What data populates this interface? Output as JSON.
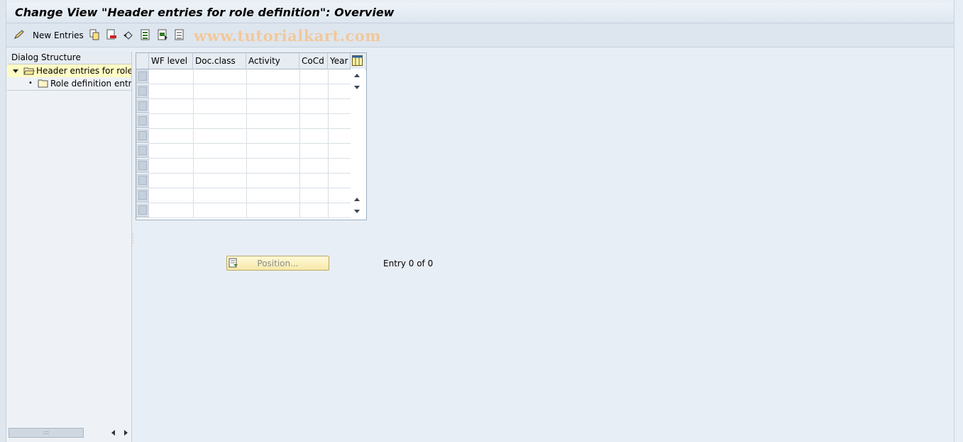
{
  "window": {
    "title": "Change View \"Header entries for role definition\": Overview"
  },
  "toolbar": {
    "new_entries_label": "New Entries",
    "watermark": "www.tutorialkart.com",
    "icons": [
      "edit-pencil-icon",
      "copy-icon",
      "delete-icon",
      "undo-icon",
      "select-all-icon",
      "select-block-icon",
      "deselect-all-icon"
    ]
  },
  "tree": {
    "header": "Dialog Structure",
    "items": [
      {
        "label": "Header entries for role d",
        "selected": true
      },
      {
        "label": "Role definition entrie",
        "selected": false
      }
    ]
  },
  "table": {
    "columns": [
      "WF level",
      "Doc.class",
      "Activity",
      "CoCd",
      "Year"
    ],
    "row_count": 10
  },
  "position_button": {
    "label": "Position..."
  },
  "entry_info": "Entry 0 of 0",
  "colors": {
    "title_bg": "#e4ebf2",
    "selected_tree_row": "#fffbc4",
    "button_bg": "#f7e9a8",
    "watermark": "#f2c89a"
  }
}
